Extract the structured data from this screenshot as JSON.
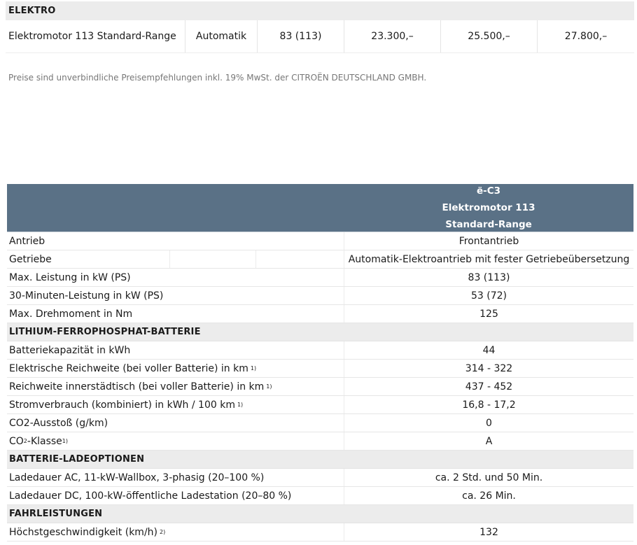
{
  "price_table": {
    "section_title": "ELEKTRO",
    "row": [
      "Elektromotor 113 Standard-Range",
      "Automatik",
      "83 (113)",
      "23.300,–",
      "25.500,–",
      "27.800,–"
    ]
  },
  "footnote": "Preise sind unverbindliche Preisempfehlungen inkl. 19% MwSt. der CITROËN DEUTSCHLAND GMBH.",
  "spec_table": {
    "header": [
      "ë-C3",
      "Elektromotor 113",
      "Standard-Range"
    ],
    "antrieb": {
      "label": "Antrieb",
      "value": "Frontantrieb"
    },
    "getriebe": {
      "label": "Getriebe",
      "value": "Automatik-Elektroantrieb mit fester Getriebeübersetzung"
    },
    "leistung": {
      "label": "Max. Leistung in kW (PS)",
      "value": "83 (113)"
    },
    "leistung30": {
      "label": "30-Minuten-Leistung in kW (PS)",
      "value": "53 (72)"
    },
    "drehmoment": {
      "label": "Max. Drehmoment in Nm",
      "value": "125"
    },
    "section_battery": "LITHIUM-FERROPHOSPHAT-BATTERIE",
    "kapazitaet": {
      "label": "Batteriekapazität in kWh",
      "value": "44"
    },
    "reichweite": {
      "label": "Elektrische Reichweite (bei voller Batterie) in km",
      "sup": "1)",
      "value": "314 - 322"
    },
    "reichweite_stadt": {
      "label": "Reichweite innerstädtisch (bei voller Batterie) in km",
      "sup": "1)",
      "value": "437 - 452"
    },
    "verbrauch": {
      "label": "Stromverbrauch (kombiniert) in kWh / 100 km",
      "sup": "1)",
      "value": "16,8 - 17,2"
    },
    "co2": {
      "label": "CO2-Ausstoß (g/km)",
      "value": "0"
    },
    "co2_klasse": {
      "label_pre": "CO",
      "label_sub": "2",
      "label_post": "-Klasse",
      "sup": "1)",
      "value": "A"
    },
    "section_lade": "BATTERIE-LADEOPTIONEN",
    "lade_ac": {
      "label": "Ladedauer AC, 11-kW-Wallbox, 3-phasig (20–100 %)",
      "value": "ca. 2 Std. und 50 Min."
    },
    "lade_dc": {
      "label": "Ladedauer DC, 100-kW-öffentliche Ladestation (20–80 %)",
      "value": "ca. 26 Min."
    },
    "section_fahr": "FAHRLEISTUNGEN",
    "vmax": {
      "label": "Höchstgeschwindigkeit (km/h)",
      "sup": "2)",
      "value": "132"
    }
  }
}
